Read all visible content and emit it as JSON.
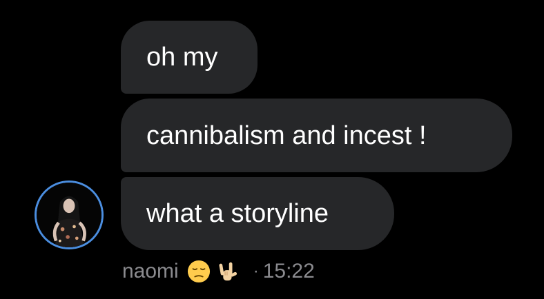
{
  "messages": [
    {
      "text": "oh my"
    },
    {
      "text": "cannibalism and incest !"
    },
    {
      "text": "what a storyline"
    }
  ],
  "sender": {
    "name": "naomi",
    "emojis": [
      "pensive-face-emoji",
      "love-you-gesture-emoji"
    ],
    "separator": "·",
    "time": "15:22"
  },
  "colors": {
    "background": "#000000",
    "bubble": "#262729",
    "text": "#ffffff",
    "meta_text": "#8b8b8f",
    "avatar_ring": "#4b8ee0"
  }
}
